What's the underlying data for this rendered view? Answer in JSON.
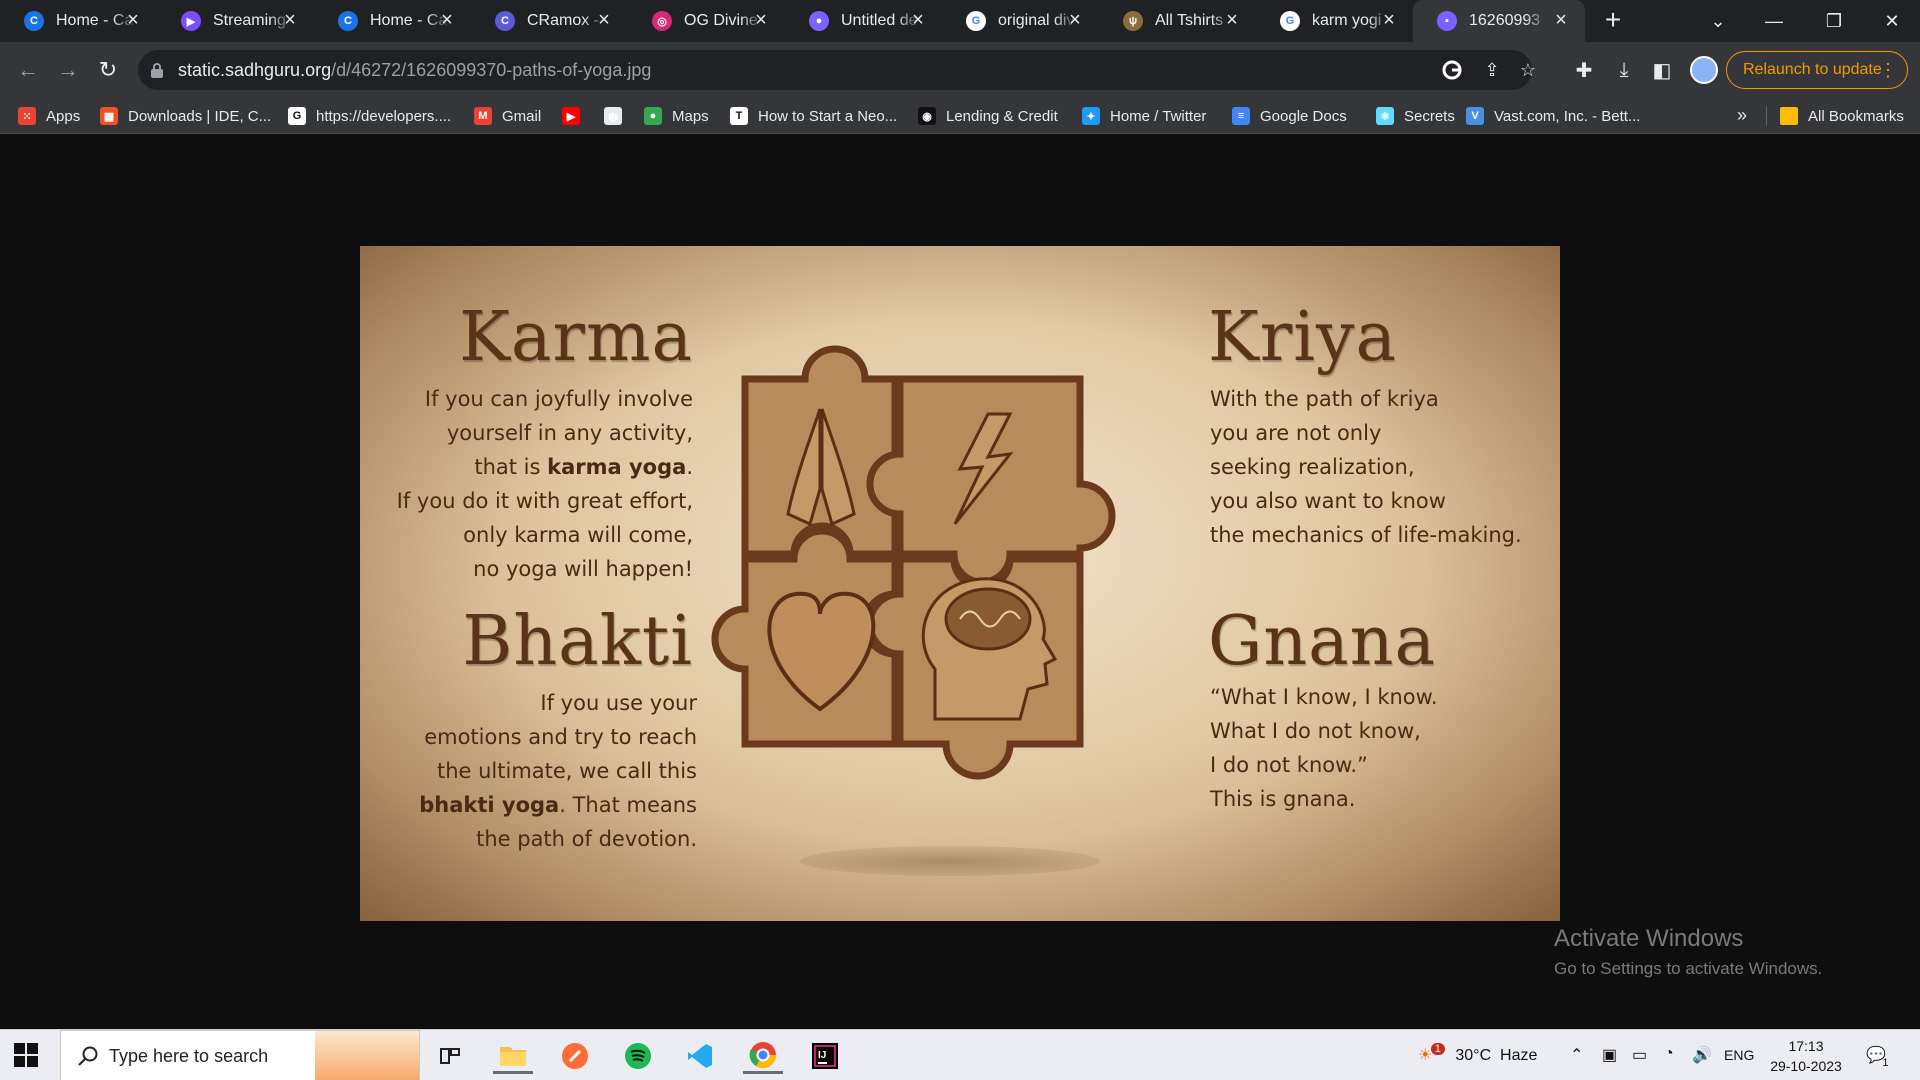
{
  "browser": {
    "tabs": [
      {
        "title": "Home - Ca",
        "icon": "canva-icon",
        "color": "#1a73e8",
        "glyph": "C",
        "active": false
      },
      {
        "title": "Streaming",
        "icon": "stream-video-icon",
        "color": "#7c4dff",
        "glyph": "▶",
        "active": false
      },
      {
        "title": "Home - Ca",
        "icon": "canva-icon",
        "color": "#1a73e8",
        "glyph": "C",
        "active": false
      },
      {
        "title": "CRamox - \\",
        "icon": "app-icon",
        "color": "#5b5bd6",
        "glyph": "C",
        "active": false
      },
      {
        "title": "OG Divine",
        "icon": "instagram-icon",
        "color": "#d62976",
        "glyph": "◎",
        "active": false
      },
      {
        "title": "Untitled de",
        "icon": "canva-doc-icon",
        "color": "#7b61ff",
        "glyph": "●",
        "active": false
      },
      {
        "title": "original div",
        "icon": "google-icon",
        "color": "#ffffff",
        "glyph": "G",
        "active": false
      },
      {
        "title": "All Tshirts",
        "icon": "trident-icon",
        "color": "#8a6d3b",
        "glyph": "ψ",
        "active": false
      },
      {
        "title": "karm yogi",
        "icon": "google-icon",
        "color": "#ffffff",
        "glyph": "G",
        "active": false
      },
      {
        "title": "16260993",
        "icon": "image-tab-icon",
        "color": "#7b61ff",
        "glyph": "▪",
        "active": true
      }
    ],
    "address": {
      "host": "static.sadhguru.org",
      "path": "/d/46272/1626099370-paths-of-yoga.jpg"
    },
    "relaunch_label": "Relaunch to update",
    "bookmarks": [
      {
        "label": "Apps",
        "icon": "apps-grid-icon",
        "color": "#ea4335"
      },
      {
        "label": "Downloads | IDE, C...",
        "icon": "microsoft-icon",
        "color": "#f25022"
      },
      {
        "label": "https://developers....",
        "icon": "google-icon",
        "color": "#ffffff"
      },
      {
        "label": "Gmail",
        "icon": "gmail-icon",
        "color": "#ea4335"
      },
      {
        "label": "",
        "icon": "youtube-icon",
        "color": "#ff0000"
      },
      {
        "label": "",
        "icon": "globe-icon",
        "color": "#e8eaed"
      },
      {
        "label": "Maps",
        "icon": "maps-pin-icon",
        "color": "#34a853"
      },
      {
        "label": "How to Start a Neo...",
        "icon": "t-logo-icon",
        "color": "#ffffff"
      },
      {
        "label": "Lending & Credit",
        "icon": "circle-logo-icon",
        "color": "#111111"
      },
      {
        "label": "Home / Twitter",
        "icon": "twitter-icon",
        "color": "#1d9bf0"
      },
      {
        "label": "Google Docs",
        "icon": "docs-icon",
        "color": "#4285f4"
      },
      {
        "label": "Secrets",
        "icon": "react-icon",
        "color": "#61dafb"
      },
      {
        "label": "Vast.com, Inc. - Bett...",
        "icon": "vast-icon",
        "color": "#4a90e2"
      }
    ],
    "all_bookmarks_label": "All Bookmarks"
  },
  "poster": {
    "karma": {
      "title": "Karma",
      "lines": [
        "If you can joyfully involve",
        "yourself in any activity,",
        "that is |karma yoga|.",
        "If you do it with great effort,",
        "only karma will come,",
        "no yoga will happen!"
      ]
    },
    "bhakti": {
      "title": "Bhakti",
      "lines": [
        "If you use your",
        "emotions and try to reach",
        "the ultimate, we call this",
        "|bhakti yoga|. That means",
        "the path of devotion."
      ]
    },
    "kriya": {
      "title": "Kriya",
      "lines": [
        "With the path of kriya",
        "you are not only",
        "seeking realization,",
        "you also want to know",
        "the mechanics of life-making."
      ]
    },
    "gnana": {
      "title": "Gnana",
      "lines": [
        "“What I know, I know.",
        "What I do not know,",
        "I do not know.”",
        "This is gnana."
      ]
    },
    "puzzle_pieces": [
      "praying-hands-icon",
      "lightning-icon",
      "heart-icon",
      "head-brain-icon"
    ],
    "colors": {
      "paper": "#e6cfab",
      "ink": "#4a2a12",
      "piece": "#b98a5c",
      "piece_border": "#6b3a1c"
    }
  },
  "watermark": {
    "line1": "Activate Windows",
    "line2": "Go to Settings to activate Windows."
  },
  "taskbar": {
    "search_placeholder": "Type here to search",
    "apps": [
      "task-view-icon",
      "file-explorer-icon",
      "postman-icon",
      "spotify-icon",
      "vscode-icon",
      "chrome-icon",
      "intellij-icon"
    ],
    "weather": "30°C  Haze",
    "weather_badge": "1",
    "language": "ENG",
    "time": "17:13",
    "date": "29-10-2023",
    "notifications": "1"
  }
}
